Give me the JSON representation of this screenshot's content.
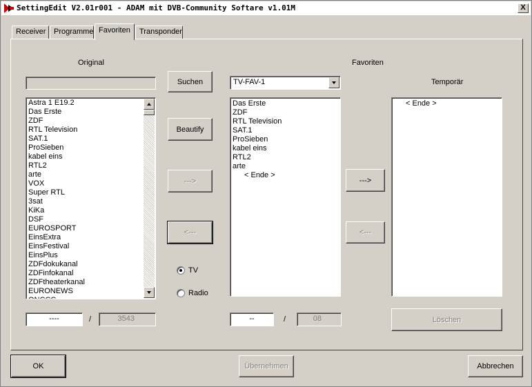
{
  "window": {
    "title": "SettingEdit V2.01r001 - ADAM mit DVB-Community Softare v1.01M",
    "close_label": "X"
  },
  "tabs": [
    {
      "label": "Receiver",
      "active": false
    },
    {
      "label": "Programme",
      "active": false
    },
    {
      "label": "Favoriten",
      "active": true
    },
    {
      "label": "Transponder",
      "active": false
    }
  ],
  "original": {
    "label": "Original",
    "search_value": "",
    "items": [
      "Astra 1 E19.2",
      "Das Erste",
      "ZDF",
      "RTL Television",
      "SAT.1",
      "ProSieben",
      "kabel eins",
      "RTL2",
      "arte",
      "VOX",
      "Super RTL",
      "3sat",
      "KiKa",
      "DSF",
      "EUROSPORT",
      "EinsExtra",
      "EinsFestival",
      "EinsPlus",
      "ZDFdokukanal",
      "ZDFinfokanal",
      "ZDFtheaterkanal",
      "EURONEWS",
      "ONCCC"
    ],
    "counter_value": "----",
    "counter_separator": "/",
    "counter_total": "3543"
  },
  "buttons": {
    "search": "Suchen",
    "beautify": "Beautify",
    "add_to_fav": "--->",
    "remove_from_fav": "<---",
    "to_temp": "--->",
    "from_temp": "<---",
    "delete": "Löschen",
    "ok": "OK",
    "apply": "Übernehmen",
    "cancel": "Abbrechen"
  },
  "mode": {
    "tv_label": "TV",
    "radio_label": "Radio",
    "selected": "TV"
  },
  "favorites": {
    "label": "Favoriten",
    "selected_list": "TV-FAV-1",
    "items": [
      "Das Erste",
      "ZDF",
      "RTL Television",
      "SAT.1",
      "ProSieben",
      "kabel eins",
      "RTL2",
      "arte"
    ],
    "end_marker": "< Ende >",
    "counter_value": "--",
    "counter_separator": "/",
    "counter_total": "08"
  },
  "temporary": {
    "label": "Temporär",
    "end_marker": "< Ende >"
  }
}
